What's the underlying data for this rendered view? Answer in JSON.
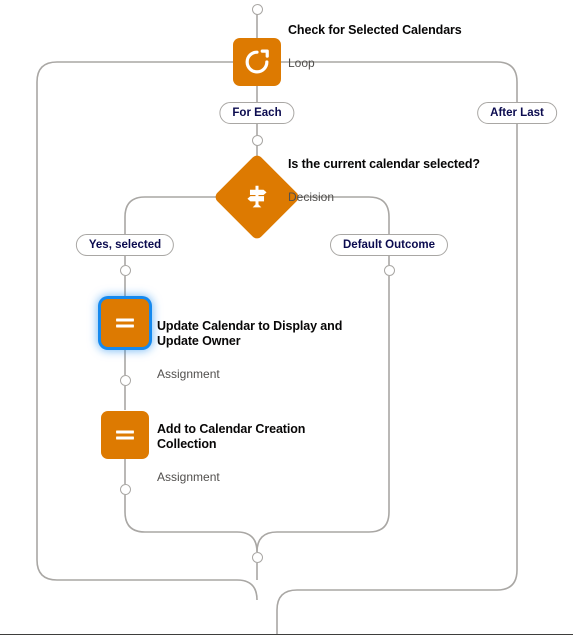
{
  "canvas": {
    "accent_color": "#dd7a01",
    "selection_color": "#1589ee",
    "connector_color": "#a9a7a4",
    "title_color": "#080707",
    "subtitle_color": "#514f4d"
  },
  "nodes": [
    {
      "id": "loop",
      "title": "Check for Selected Calendars",
      "subtitle": "Loop",
      "icon": "loop-icon",
      "selected": false
    },
    {
      "id": "decision",
      "title": "Is the current calendar selected?",
      "subtitle": "Decision",
      "icon": "decision-signpost-icon",
      "selected": false
    },
    {
      "id": "assignment-1",
      "title": "Update Calendar to Display and Update Owner",
      "subtitle": "Assignment",
      "icon": "assignment-equals-icon",
      "selected": true
    },
    {
      "id": "assignment-2",
      "title": "Add to Calendar Creation Collection",
      "subtitle": "Assignment",
      "icon": "assignment-equals-icon",
      "selected": false
    }
  ],
  "branch_labels": {
    "for_each": "For Each",
    "after_last": "After Last",
    "yes_selected": "Yes, selected",
    "default_outcome": "Default Outcome"
  }
}
